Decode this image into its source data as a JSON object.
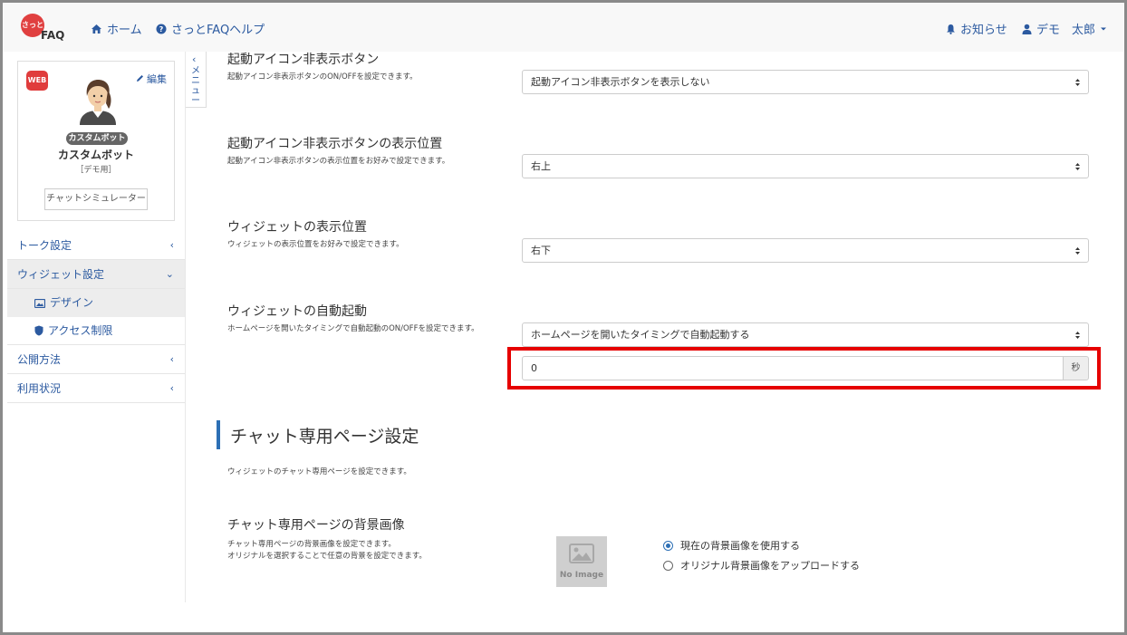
{
  "header": {
    "logo_text": "FAQ",
    "logo_mark": "さっと",
    "nav": [
      {
        "label": "ホーム",
        "icon": "home-icon"
      },
      {
        "label": "さっとFAQヘルプ",
        "icon": "help-circle-icon"
      }
    ],
    "notifications_label": "お知らせ",
    "user_label": "デモ　太郎"
  },
  "profile": {
    "badge": "WEB",
    "edit_label": "編集",
    "bot_pill": "カスタムボット",
    "bot_name": "カスタムボット",
    "bot_sub": "［デモ用］",
    "simulator_label": "チャットシミュレーター"
  },
  "sidebar": {
    "menu_tab_label": "メニュー",
    "items": [
      {
        "label": "トーク設定"
      },
      {
        "label": "ウィジェット設定"
      },
      {
        "label": "デザイン"
      },
      {
        "label": "アクセス制限"
      },
      {
        "label": "公開方法"
      },
      {
        "label": "利用状況"
      }
    ]
  },
  "settings": {
    "hide_button": {
      "title": "起動アイコン非表示ボタン",
      "desc": "起動アイコン非表示ボタンのON/OFFを設定できます。",
      "value": "起動アイコン非表示ボタンを表示しない"
    },
    "hide_button_position": {
      "title": "起動アイコン非表示ボタンの表示位置",
      "desc": "起動アイコン非表示ボタンの表示位置をお好みで設定できます。",
      "value": "右上"
    },
    "widget_position": {
      "title": "ウィジェットの表示位置",
      "desc": "ウィジェットの表示位置をお好みで設定できます。",
      "value": "右下"
    },
    "auto_launch": {
      "title": "ウィジェットの自動起動",
      "desc": "ホームページを開いたタイミングで自動起動のON/OFFを設定できます。",
      "value": "ホームページを開いたタイミングで自動起動する",
      "seconds_value": "0",
      "seconds_unit": "秒"
    }
  },
  "chat_page": {
    "heading": "チャット専用ページ設定",
    "desc": "ウィジェットのチャット専用ページを設定できます。",
    "bg_title": "チャット専用ページの背景画像",
    "bg_desc_1": "チャット専用ページの背景画像を設定できます。",
    "bg_desc_2": "オリジナルを選択することで任意の背景を設定できます。",
    "no_image": "No Image",
    "options": [
      {
        "label": "現在の背景画像を使用する",
        "selected": true
      },
      {
        "label": "オリジナル背景画像をアップロードする",
        "selected": false
      }
    ]
  },
  "colors": {
    "accent": "#2c5aa0",
    "highlight": "#e60000"
  }
}
